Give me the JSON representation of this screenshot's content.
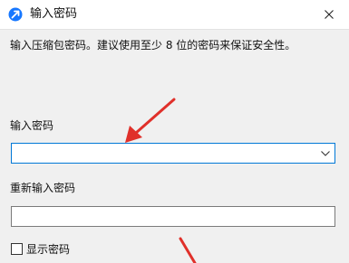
{
  "window": {
    "title": "输入密码",
    "app_icon": "blue-circle-arrow-icon",
    "close_icon": "close-icon"
  },
  "dialog": {
    "description": "输入压缩包密码。建议使用至少 8 位的密码来保证安全性。",
    "password_label": "输入密码",
    "password_value": "",
    "confirm_label": "重新输入密码",
    "confirm_value": "",
    "show_password_label": "显示密码",
    "show_password_checked": false
  },
  "colors": {
    "accent": "#0078d7",
    "annotation_arrow": "#e0302a",
    "background": "#f0f0f0"
  }
}
